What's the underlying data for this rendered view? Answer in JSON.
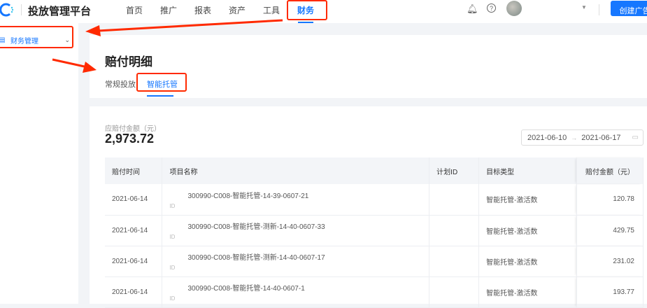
{
  "header": {
    "title": "投放管理平台",
    "nav": [
      "首页",
      "推广",
      "报表",
      "资产",
      "工具",
      "财务"
    ],
    "active_nav": "财务",
    "create_button": "创建广告"
  },
  "sidebar": {
    "item": "财务管理"
  },
  "page": {
    "title": "赔付明细",
    "tabs": [
      "常规投放",
      "智能托管"
    ],
    "active_tab": "智能托管"
  },
  "summary": {
    "label": "应赔付金额（元）",
    "value": "2,973.72"
  },
  "date_range": {
    "start": "2021-06-10",
    "end": "2021-06-17"
  },
  "table": {
    "columns": [
      "赔付时间",
      "项目名称",
      "计划ID",
      "目标类型",
      "赔付金额（元）"
    ],
    "rows": [
      {
        "time": "2021-06-14",
        "name": "300990-C008-智能托管-14-39-0607-21",
        "id": "ID",
        "plan_id": "",
        "type": "智能托管-激活数",
        "amount": "120.78"
      },
      {
        "time": "2021-06-14",
        "name": "300990-C008-智能托管-测新-14-40-0607-33",
        "id": "ID",
        "plan_id": "",
        "type": "智能托管-激活数",
        "amount": "429.75"
      },
      {
        "time": "2021-06-14",
        "name": "300990-C008-智能托管-测新-14-40-0607-17",
        "id": "ID",
        "plan_id": "",
        "type": "智能托管-激活数",
        "amount": "231.02"
      },
      {
        "time": "2021-06-14",
        "name": "300990-C008-智能托管-14-40-0607-1",
        "id": "ID",
        "plan_id": "",
        "type": "智能托管-激活数",
        "amount": "193.77"
      }
    ]
  },
  "colors": {
    "accent": "#1677ff",
    "annotation": "#ff2a00"
  }
}
